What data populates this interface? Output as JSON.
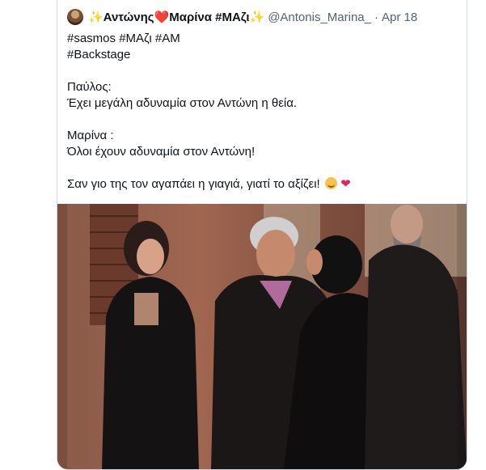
{
  "tweet": {
    "display_name": "✨Αντώνης❤️Μαρίνα #ΜΑζι✨",
    "handle": "@Antonis_Marina_",
    "separator": "·",
    "date": "Apr 18",
    "lines": {
      "hashtags1": "#sasmos #ΜΑζι #ΑΜ",
      "hashtags2": "#Backstage",
      "speaker1": "Παύλος:",
      "quote1": "Έχει μεγάλη αδυναμία στον Αντώνη η θεία.",
      "speaker2": "Μαρίνα :",
      "quote2": "Όλοι έχουν αδυναμία στον Αντώνη!",
      "closing": "Σαν γιο της τον αγαπάει η γιαγιά, γιατί το αξίζει!"
    },
    "closing_heart": "❤"
  },
  "media": {
    "icon": "photo-icon"
  },
  "colors": {
    "text": "#0f1419",
    "muted": "#536471",
    "border": "#cfd9de",
    "heart": "#e0245e"
  }
}
